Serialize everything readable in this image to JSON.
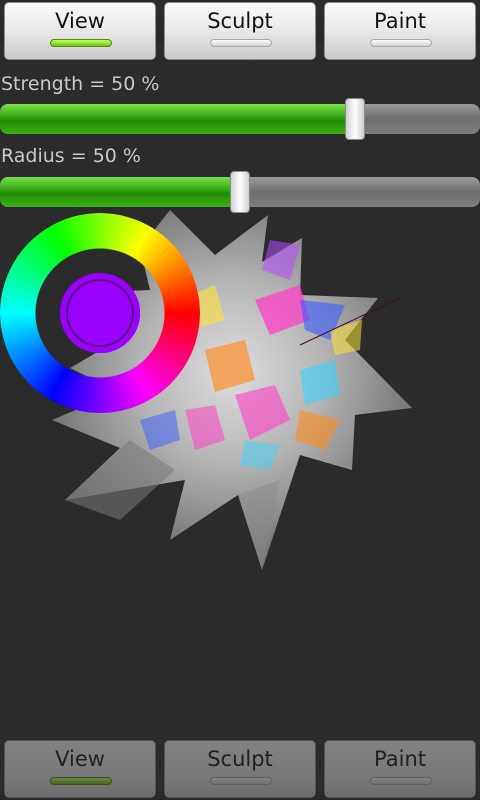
{
  "top_tabs": [
    {
      "label": "View",
      "selected": true
    },
    {
      "label": "Sculpt",
      "selected": false
    },
    {
      "label": "Paint",
      "selected": false
    }
  ],
  "bottom_tabs": [
    {
      "label": "View",
      "selected": true
    },
    {
      "label": "Sculpt",
      "selected": false
    },
    {
      "label": "Paint",
      "selected": false
    }
  ],
  "strength": {
    "label": "Strength = 50 %",
    "value_fraction": 0.75
  },
  "radius": {
    "label": "Radius = 50 %",
    "value_fraction": 0.5
  },
  "color_picker": {
    "selected_color": "#9900ff"
  },
  "colors": {
    "accent_green": "#2fa10f",
    "background": "#2b2b2b"
  },
  "icons": {
    "mesh": "sculpt-mesh-icon"
  }
}
